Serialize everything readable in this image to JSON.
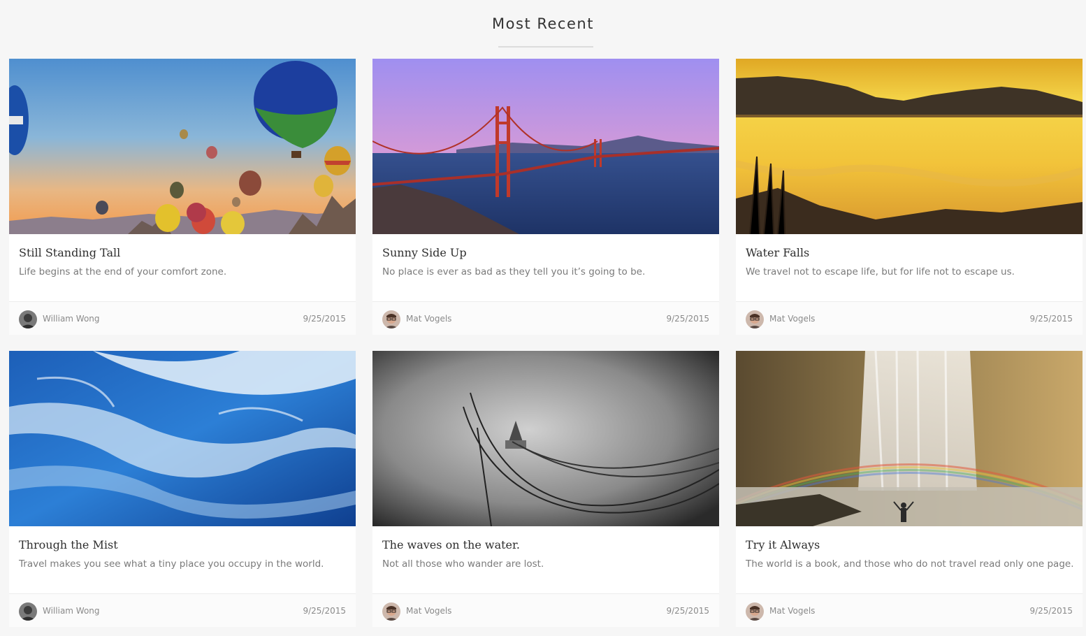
{
  "section": {
    "title": "Most Recent"
  },
  "posts": [
    {
      "title": "Still Standing Tall",
      "excerpt": "Life begins at the end of your comfort zone.",
      "author": "William Wong",
      "date": "9/25/2015",
      "image": "hot-air-balloons"
    },
    {
      "title": "Sunny Side Up",
      "excerpt": "No place is ever as bad as they tell you it’s going to be.",
      "author": "Mat Vogels",
      "date": "9/25/2015",
      "image": "golden-gate-bridge"
    },
    {
      "title": "Water Falls",
      "excerpt": "We travel not to escape life, but for life not to escape us.",
      "author": "Mat Vogels",
      "date": "9/25/2015",
      "image": "golden-lake"
    },
    {
      "title": "Through the Mist",
      "excerpt": "Travel makes you see what a tiny place you occupy in the world.",
      "author": "William Wong",
      "date": "9/25/2015",
      "image": "ocean-waves"
    },
    {
      "title": "The waves on the water.",
      "excerpt": "Not all those who wander are lost.",
      "author": "Mat Vogels",
      "date": "9/25/2015",
      "image": "misty-cables"
    },
    {
      "title": "Try it Always",
      "excerpt": "The world is a book, and those who do not travel read only one page.",
      "author": "Mat Vogels",
      "date": "9/25/2015",
      "image": "waterfall-rainbow"
    }
  ]
}
